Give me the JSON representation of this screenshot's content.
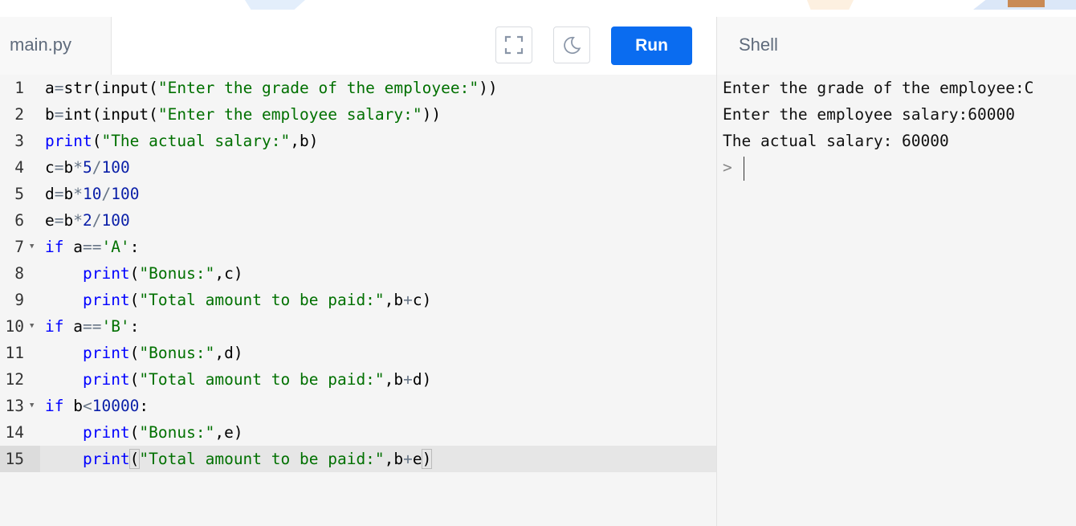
{
  "editor": {
    "filename": "main.py",
    "run_label": "Run",
    "lines": [
      {
        "num": "1",
        "fold": false,
        "tokens": [
          [
            "",
            "a"
          ],
          [
            "op",
            "="
          ],
          [
            "",
            "str(input("
          ],
          [
            "str",
            "\"Enter the grade of the employee:\""
          ],
          [
            "",
            "))"
          ]
        ]
      },
      {
        "num": "2",
        "fold": false,
        "tokens": [
          [
            "",
            "b"
          ],
          [
            "op",
            "="
          ],
          [
            "",
            "int(input("
          ],
          [
            "str",
            "\"Enter the employee salary:\""
          ],
          [
            "",
            "))"
          ]
        ]
      },
      {
        "num": "3",
        "fold": false,
        "tokens": [
          [
            "kw",
            "print"
          ],
          [
            "",
            "("
          ],
          [
            "str",
            "\"The actual salary:\""
          ],
          [
            "",
            ",b)"
          ]
        ]
      },
      {
        "num": "4",
        "fold": false,
        "tokens": [
          [
            "",
            "c"
          ],
          [
            "op",
            "="
          ],
          [
            "",
            "b"
          ],
          [
            "op",
            "*"
          ],
          [
            "num",
            "5"
          ],
          [
            "op",
            "/"
          ],
          [
            "num",
            "100"
          ]
        ]
      },
      {
        "num": "5",
        "fold": false,
        "tokens": [
          [
            "",
            "d"
          ],
          [
            "op",
            "="
          ],
          [
            "",
            "b"
          ],
          [
            "op",
            "*"
          ],
          [
            "num",
            "10"
          ],
          [
            "op",
            "/"
          ],
          [
            "num",
            "100"
          ]
        ]
      },
      {
        "num": "6",
        "fold": false,
        "tokens": [
          [
            "",
            "e"
          ],
          [
            "op",
            "="
          ],
          [
            "",
            "b"
          ],
          [
            "op",
            "*"
          ],
          [
            "num",
            "2"
          ],
          [
            "op",
            "/"
          ],
          [
            "num",
            "100"
          ]
        ]
      },
      {
        "num": "7",
        "fold": true,
        "tokens": [
          [
            "kw",
            "if"
          ],
          [
            "",
            " a"
          ],
          [
            "op",
            "=="
          ],
          [
            "str",
            "'A'"
          ],
          [
            "",
            ":"
          ]
        ]
      },
      {
        "num": "8",
        "fold": false,
        "tokens": [
          [
            "",
            "    "
          ],
          [
            "kw",
            "print"
          ],
          [
            "",
            "("
          ],
          [
            "str",
            "\"Bonus:\""
          ],
          [
            "",
            ",c)"
          ]
        ]
      },
      {
        "num": "9",
        "fold": false,
        "tokens": [
          [
            "",
            "    "
          ],
          [
            "kw",
            "print"
          ],
          [
            "",
            "("
          ],
          [
            "str",
            "\"Total amount to be paid:\""
          ],
          [
            "",
            ",b"
          ],
          [
            "op",
            "+"
          ],
          [
            "",
            "c)"
          ]
        ]
      },
      {
        "num": "10",
        "fold": true,
        "tokens": [
          [
            "kw",
            "if"
          ],
          [
            "",
            " a"
          ],
          [
            "op",
            "=="
          ],
          [
            "str",
            "'B'"
          ],
          [
            "",
            ":"
          ]
        ]
      },
      {
        "num": "11",
        "fold": false,
        "tokens": [
          [
            "",
            "    "
          ],
          [
            "kw",
            "print"
          ],
          [
            "",
            "("
          ],
          [
            "str",
            "\"Bonus:\""
          ],
          [
            "",
            ",d)"
          ]
        ]
      },
      {
        "num": "12",
        "fold": false,
        "tokens": [
          [
            "",
            "    "
          ],
          [
            "kw",
            "print"
          ],
          [
            "",
            "("
          ],
          [
            "str",
            "\"Total amount to be paid:\""
          ],
          [
            "",
            ",b"
          ],
          [
            "op",
            "+"
          ],
          [
            "",
            "d)"
          ]
        ]
      },
      {
        "num": "13",
        "fold": true,
        "tokens": [
          [
            "kw",
            "if"
          ],
          [
            "",
            " b"
          ],
          [
            "op",
            "<"
          ],
          [
            "num",
            "10000"
          ],
          [
            "",
            ":"
          ]
        ]
      },
      {
        "num": "14",
        "fold": false,
        "tokens": [
          [
            "",
            "    "
          ],
          [
            "kw",
            "print"
          ],
          [
            "",
            "("
          ],
          [
            "str",
            "\"Bonus:\""
          ],
          [
            "",
            ",e)"
          ]
        ]
      },
      {
        "num": "15",
        "fold": false,
        "active": true,
        "tokens": [
          [
            "",
            "    "
          ],
          [
            "kw",
            "print"
          ],
          [
            "bh",
            "("
          ],
          [
            "str",
            "\"Total amount to be paid:\""
          ],
          [
            "",
            ",b"
          ],
          [
            "op",
            "+"
          ],
          [
            "",
            "e"
          ],
          [
            "bh",
            ")"
          ]
        ]
      }
    ]
  },
  "shell": {
    "title": "Shell",
    "output": [
      "Enter the grade of the employee:C",
      "Enter the employee salary:60000",
      "The actual salary: 60000"
    ],
    "prompt": ">"
  }
}
